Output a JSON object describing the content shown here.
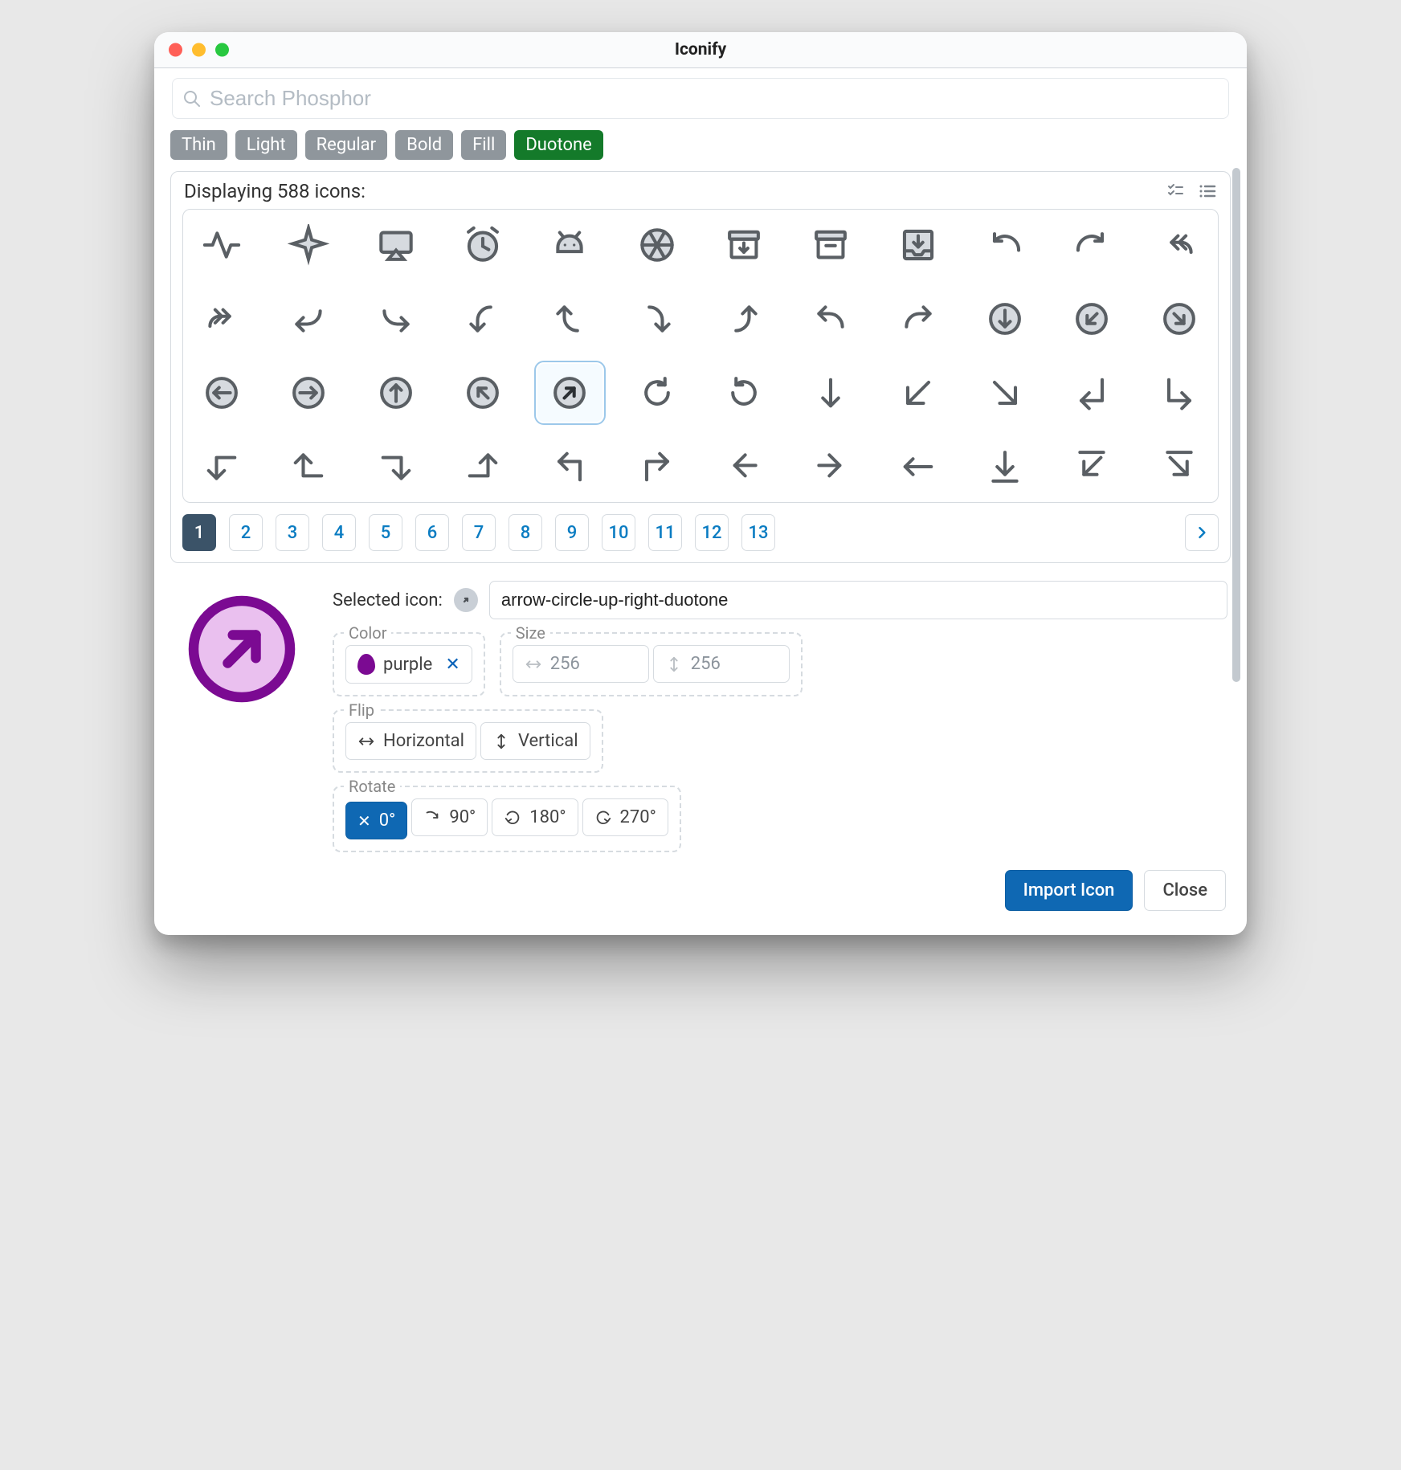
{
  "window": {
    "title": "Iconify"
  },
  "search": {
    "placeholder": "Search Phosphor"
  },
  "styles": {
    "items": [
      "Thin",
      "Light",
      "Regular",
      "Bold",
      "Fill",
      "Duotone"
    ],
    "active_index": 5
  },
  "grid": {
    "count_label": "Displaying 588 icons:",
    "icons": [
      "activity-duotone",
      "airplane-duotone",
      "airplay-duotone",
      "alarm-duotone",
      "android-logo-duotone",
      "aperture-duotone",
      "archive-box-duotone",
      "archive-duotone",
      "archive-tray-duotone",
      "arrow-arc-left-duotone",
      "arrow-arc-right-duotone",
      "arrow-bend-double-up-left-duotone",
      "arrow-bend-double-up-right-duotone",
      "arrow-bend-down-left-duotone",
      "arrow-bend-down-right-duotone",
      "arrow-bend-left-down-duotone",
      "arrow-bend-left-up-duotone",
      "arrow-bend-right-down-duotone",
      "arrow-bend-right-up-duotone",
      "arrow-bend-up-left-duotone",
      "arrow-bend-up-right-duotone",
      "arrow-circle-down-duotone",
      "arrow-circle-down-left-duotone",
      "arrow-circle-down-right-duotone",
      "arrow-circle-left-duotone",
      "arrow-circle-right-duotone",
      "arrow-circle-up-duotone",
      "arrow-circle-up-left-duotone",
      "arrow-circle-up-right-duotone",
      "arrow-clockwise-duotone",
      "arrow-counter-clockwise-duotone",
      "arrow-down-duotone",
      "arrow-down-left-duotone",
      "arrow-down-right-duotone",
      "arrow-elbow-down-left-duotone",
      "arrow-elbow-down-right-duotone",
      "arrow-elbow-left-down-duotone",
      "arrow-elbow-left-up-duotone",
      "arrow-elbow-right-down-duotone",
      "arrow-elbow-right-up-duotone",
      "arrow-elbow-up-left-duotone",
      "arrow-elbow-up-right-duotone",
      "arrow-fat-left-duotone",
      "arrow-fat-right-duotone",
      "arrow-left-duotone",
      "arrow-line-down-duotone",
      "arrow-line-down-left-duotone",
      "arrow-line-down-right-duotone"
    ],
    "selected_index": 28
  },
  "pagination": {
    "pages": [
      1,
      2,
      3,
      4,
      5,
      6,
      7,
      8,
      9,
      10,
      11,
      12,
      13
    ],
    "active": 1
  },
  "selected": {
    "label": "Selected icon:",
    "name": "arrow-circle-up-right-duotone",
    "color": {
      "legend": "Color",
      "value": "purple",
      "hex": "#800080"
    },
    "size": {
      "legend": "Size",
      "width_placeholder": "256",
      "height_placeholder": "256"
    },
    "flip": {
      "legend": "Flip",
      "horizontal": "Horizontal",
      "vertical": "Vertical"
    },
    "rotate": {
      "legend": "Rotate",
      "r0": "0°",
      "r90": "90°",
      "r180": "180°",
      "r270": "270°",
      "active": "0°"
    }
  },
  "footer": {
    "import": "Import Icon",
    "close": "Close"
  }
}
